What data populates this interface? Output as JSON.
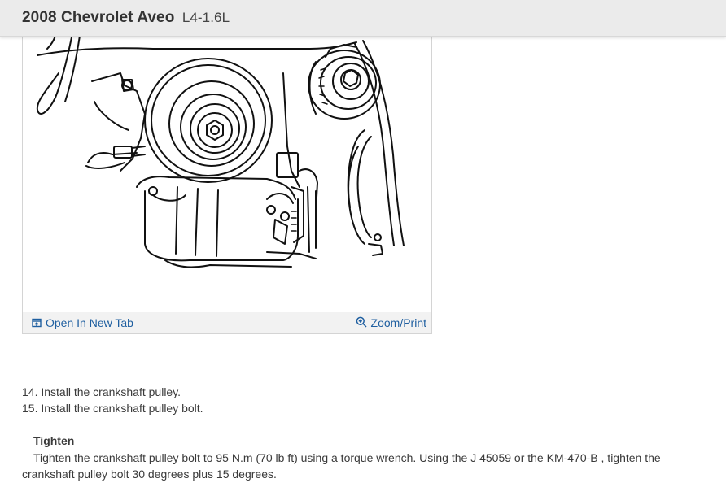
{
  "header": {
    "title": "2008 Chevrolet Aveo",
    "subtitle": "L4-1.6L"
  },
  "figure": {
    "open_tab_label": "Open In New Tab",
    "zoom_label": "Zoom/Print",
    "open_tab_icon": "open-in-new-tab-icon",
    "zoom_icon": "zoom-in-icon"
  },
  "steps": [
    {
      "text": "14. Install the crankshaft pulley."
    },
    {
      "text": "15. Install the crankshaft pulley bolt."
    }
  ],
  "tighten": {
    "label": "Tighten",
    "text": "Tighten the crankshaft pulley bolt to 95 N.m (70 lb ft) using a torque wrench. Using the J 45059 or the KM-470-B , tighten the crankshaft pulley bolt 30 degrees plus 15 degrees."
  },
  "colors": {
    "header_bg": "#ebebeb",
    "link": "#1f5fa0",
    "text": "#3a3a3a"
  }
}
